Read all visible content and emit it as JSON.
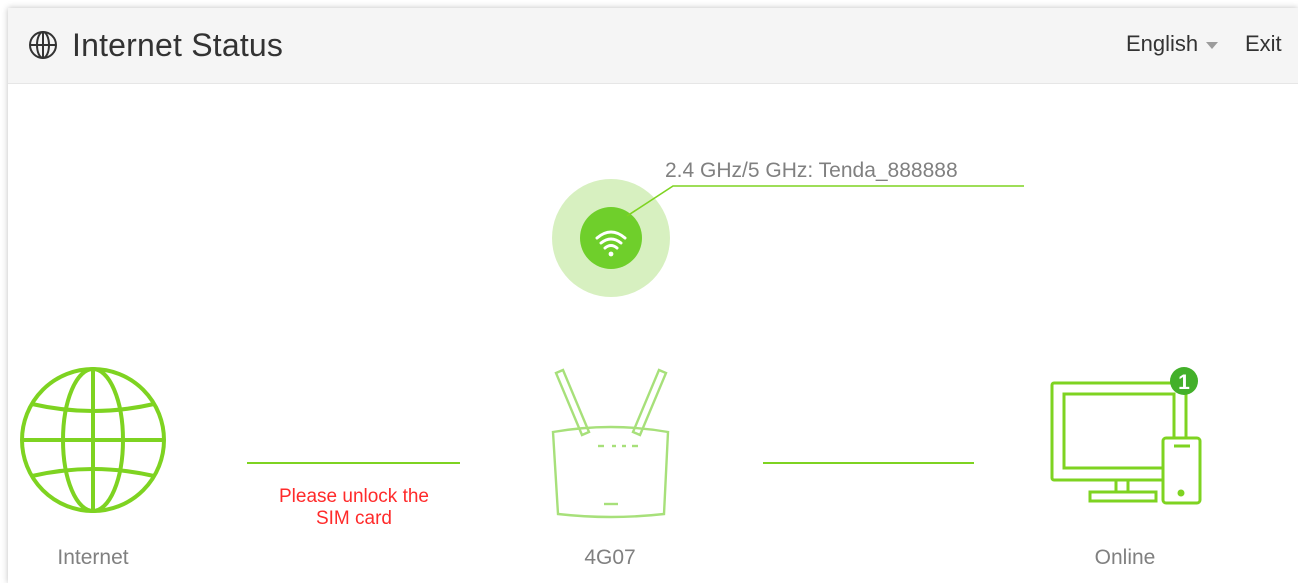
{
  "header": {
    "title": "Internet Status",
    "language": "English",
    "exit_label": "Exit"
  },
  "wifi": {
    "ssid_text": "2.4 GHz/5 GHz: Tenda_888888",
    "icon": "wifi-icon"
  },
  "nodes": {
    "internet": {
      "label": "Internet",
      "icon": "globe-icon"
    },
    "router": {
      "label": "4G07",
      "icon": "router-icon"
    },
    "clients": {
      "label": "Online",
      "icon": "devices-icon",
      "count": "1"
    }
  },
  "connection": {
    "internet_warning_line1": "Please unlock the",
    "internet_warning_line2": "SIM card"
  },
  "colors": {
    "accent_green": "#7ed321",
    "badge_green": "#43b02a",
    "warning_red": "#ff2a2a",
    "label_gray": "#808080"
  }
}
